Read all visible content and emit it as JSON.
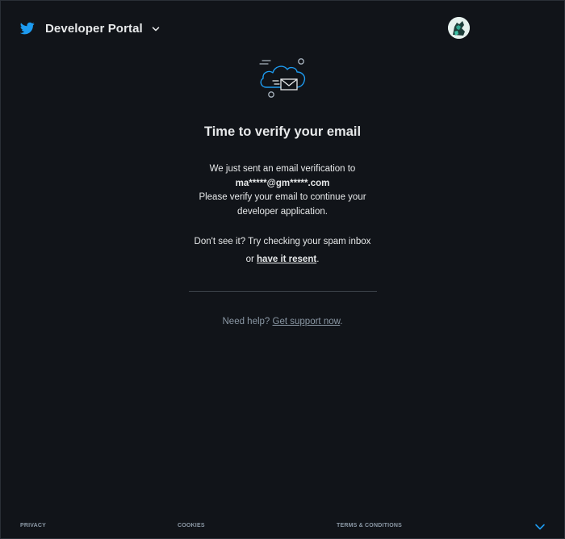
{
  "header": {
    "title": "Developer Portal"
  },
  "main": {
    "heading": "Time to verify your email",
    "sent_line": "We just sent an email verification to",
    "email": "ma*****@gm*****.com",
    "verify_line1": "Please verify your email to continue your",
    "verify_line2": "developer application.",
    "spam_line": "Don't see it? Try checking your spam inbox",
    "resend_prefix": "or ",
    "resend_link": "have it resent",
    "resend_suffix": ".",
    "help_prefix": "Need help? ",
    "help_link": "Get support now",
    "help_suffix": "."
  },
  "footer": {
    "privacy": "PRIVACY",
    "cookies": "COOKIES",
    "terms": "TERMS & CONDITIONS"
  },
  "icons": {
    "brand": "twitter-bird-icon",
    "menu": "chevron-down-icon",
    "illustration": "cloud-email-icon",
    "footer": "chevron-down-icon"
  },
  "colors": {
    "background": "#111419",
    "accent": "#1d9bf0",
    "text": "#e7e9ea",
    "muted": "#8b98a5"
  }
}
